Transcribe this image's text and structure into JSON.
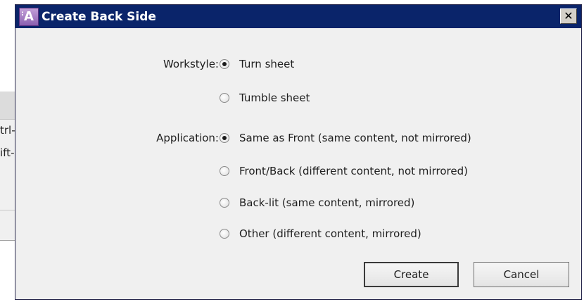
{
  "background_window": {
    "lines": [
      "trl-",
      "ift-"
    ]
  },
  "dialog": {
    "title": "Create Back Side",
    "icon_letter": "A",
    "close_label": "✕",
    "workstyle": {
      "label": "Workstyle:",
      "options": [
        {
          "label": "Turn sheet",
          "checked": true
        },
        {
          "label": "Tumble sheet",
          "checked": false
        }
      ]
    },
    "application": {
      "label": "Application:",
      "options": [
        {
          "label": "Same as Front (same content, not mirrored)",
          "checked": true
        },
        {
          "label": "Front/Back (different content, not mirrored)",
          "checked": false
        },
        {
          "label": "Back-lit (same content, mirrored)",
          "checked": false
        },
        {
          "label": "Other (different content, mirrored)",
          "checked": false
        }
      ]
    },
    "buttons": {
      "create": "Create",
      "cancel": "Cancel"
    }
  },
  "colors": {
    "titlebar": "#0a246a",
    "dialog_bg": "#f0f0f0"
  }
}
